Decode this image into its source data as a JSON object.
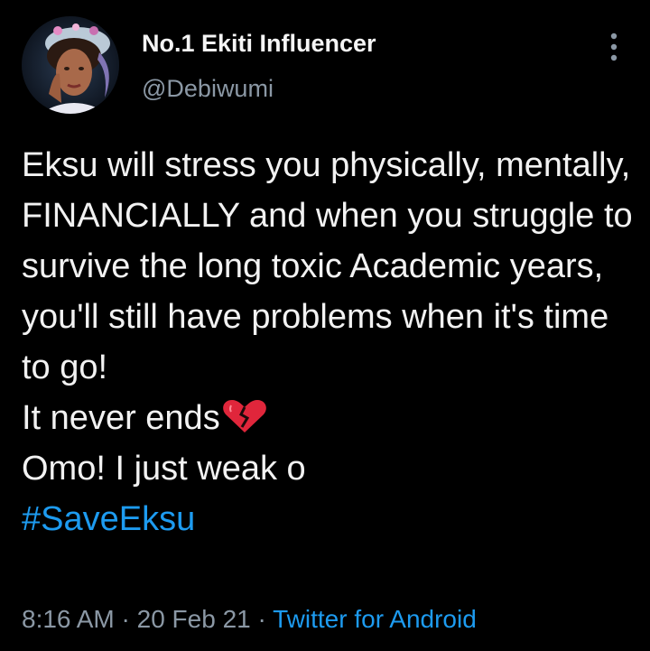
{
  "author": {
    "display_name": "No.1 Ekiti Influencer",
    "handle": "@Debiwumi"
  },
  "tweet": {
    "paragraph_1": "Eksu will stress you physically, mentally, FINANCIALLY and when you struggle to survive the long toxic Academic years, you'll still have problems when it's time to go!",
    "line_2": "It never ends",
    "emoji_2": "broken-heart-icon",
    "line_3": "Omo! I just weak o",
    "hashtag": "#SaveEksu"
  },
  "meta": {
    "time": "8:16 AM",
    "separator_1": " · ",
    "date": "20 Feb 21",
    "separator_2": " · ",
    "source": "Twitter for Android"
  },
  "colors": {
    "background": "#000000",
    "text": "#f2f2f2",
    "secondary_text": "#8b98a5",
    "link": "#1d9bf0",
    "heart": "#e0263b"
  }
}
